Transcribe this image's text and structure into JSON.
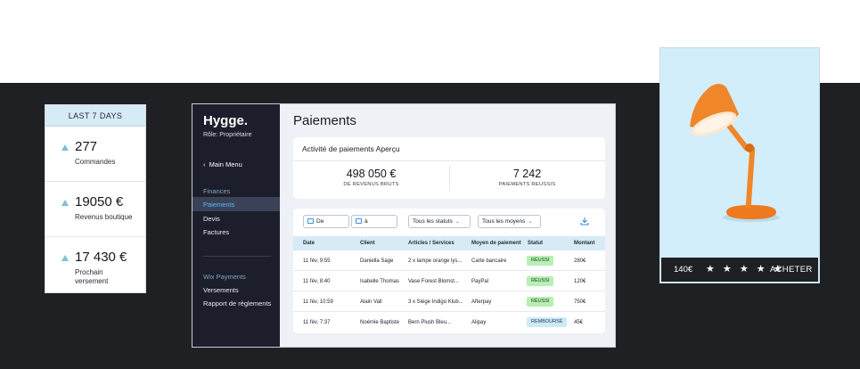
{
  "stats_card": {
    "header": "LAST 7 DAYS",
    "items": [
      {
        "value": "277",
        "label": "Commandes"
      },
      {
        "value": "19050 €",
        "label": "Revenus boutique"
      },
      {
        "value": "17 430 €",
        "label": "Prochain versement"
      }
    ],
    "accent": "#7dbfdc"
  },
  "app": {
    "brand": "Hygge.",
    "role": "Rôle: Propriétaire",
    "main_menu": "Main Menu",
    "sections": [
      {
        "title": "Finances",
        "items": [
          "Paiements",
          "Devis",
          "Factures"
        ]
      },
      {
        "title": "Wix Payments",
        "items": [
          "Versements",
          "Rapport de règlements"
        ]
      }
    ],
    "active_item": "Paiements",
    "page_title": "Paiements",
    "overview": {
      "title": "Activité de paiements Aperçu",
      "metrics": [
        {
          "value": "498 050 €",
          "label": "DE REVENUS BRUTS"
        },
        {
          "value": "7 242",
          "label": "PAIEMENTS REUSSIS"
        }
      ]
    },
    "filters": {
      "date_from": "De",
      "date_to": "à",
      "status": "Tous les statuts",
      "method": "Tous les moyens"
    },
    "table": {
      "headers": [
        "Date",
        "Client",
        "Articles /  Services",
        "Moyen de paiement",
        "Statut",
        "Montant"
      ],
      "rows": [
        {
          "date": "11 fév, 9:55",
          "client": "Daniella Sage",
          "articles": "2 x lampe orange lys...",
          "method": "Carte bancaire",
          "status": "RÉUSSI",
          "amount": "280€"
        },
        {
          "date": "11 fév, 8:40",
          "client": "Isabelle Thomas",
          "articles": "Vase Forest Blomst...",
          "method": "PayPal",
          "status": "RÉUSSI",
          "amount": "120€"
        },
        {
          "date": "11 fév, 10:59",
          "client": "Alain Vall",
          "articles": "3 x Siège Indigo Klub...",
          "method": "Afterpay",
          "status": "RÉUSSI",
          "amount": "750€"
        },
        {
          "date": "11 fév, 7:37",
          "client": "Noémie Baptiste",
          "articles": "Bern Plush Bleu...",
          "method": "Alipay",
          "status": "REMBOURSÉ",
          "amount": "45€"
        }
      ]
    },
    "colors": {
      "sidebar": "#1c1f2b",
      "active": "#58b7ff",
      "success_badge": "#b8efb2",
      "refund_badge": "#cdeaf6"
    }
  },
  "product": {
    "price": "140€",
    "rating": "★ ★ ★ ★ ★",
    "buy_label": "ACHETER",
    "image_subject": "orange desk lamp"
  }
}
